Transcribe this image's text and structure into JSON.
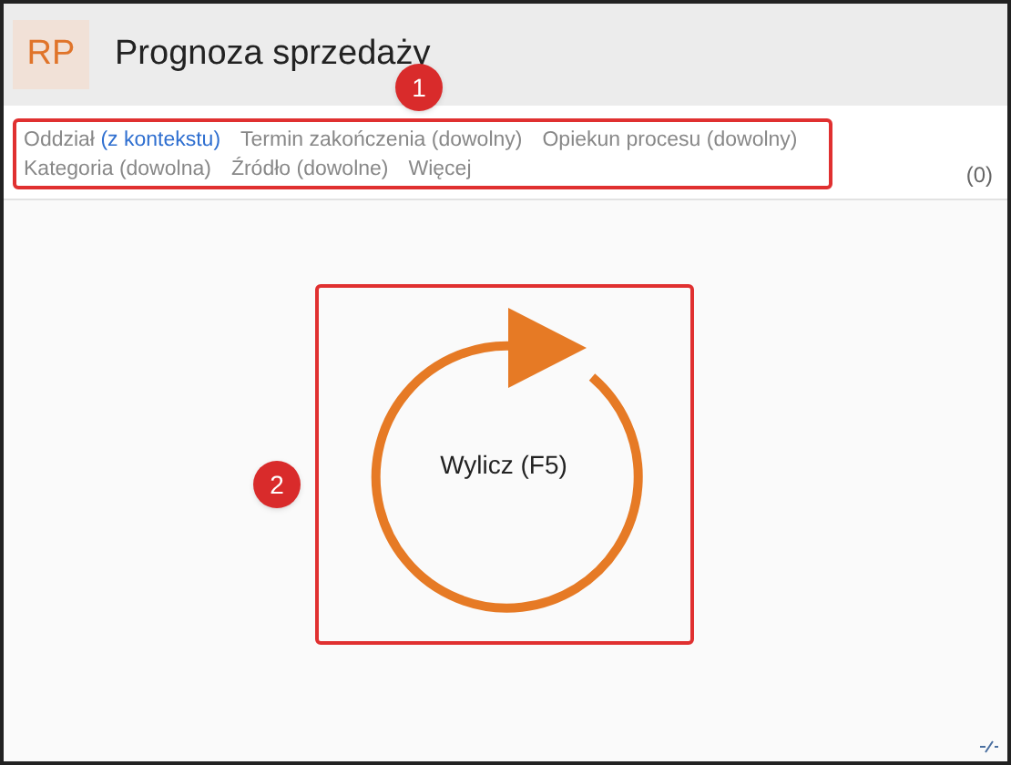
{
  "header": {
    "logo": "RP",
    "title": "Prognoza sprzedaży"
  },
  "filters": [
    {
      "label": "Oddział",
      "qualifier": "(z kontekstu)",
      "set": true
    },
    {
      "label": "Termin zakończenia",
      "qualifier": "(dowolny)",
      "set": false
    },
    {
      "label": "Opiekun procesu",
      "qualifier": "(dowolny)",
      "set": false
    },
    {
      "label": "Kategoria",
      "qualifier": "(dowolna)",
      "set": false
    },
    {
      "label": "Źródło",
      "qualifier": "(dowolne)",
      "set": false
    },
    {
      "label": "Więcej"
    }
  ],
  "count": "(0)",
  "action": {
    "label": "Wylicz (F5)"
  },
  "annotations": [
    "1",
    "2"
  ]
}
